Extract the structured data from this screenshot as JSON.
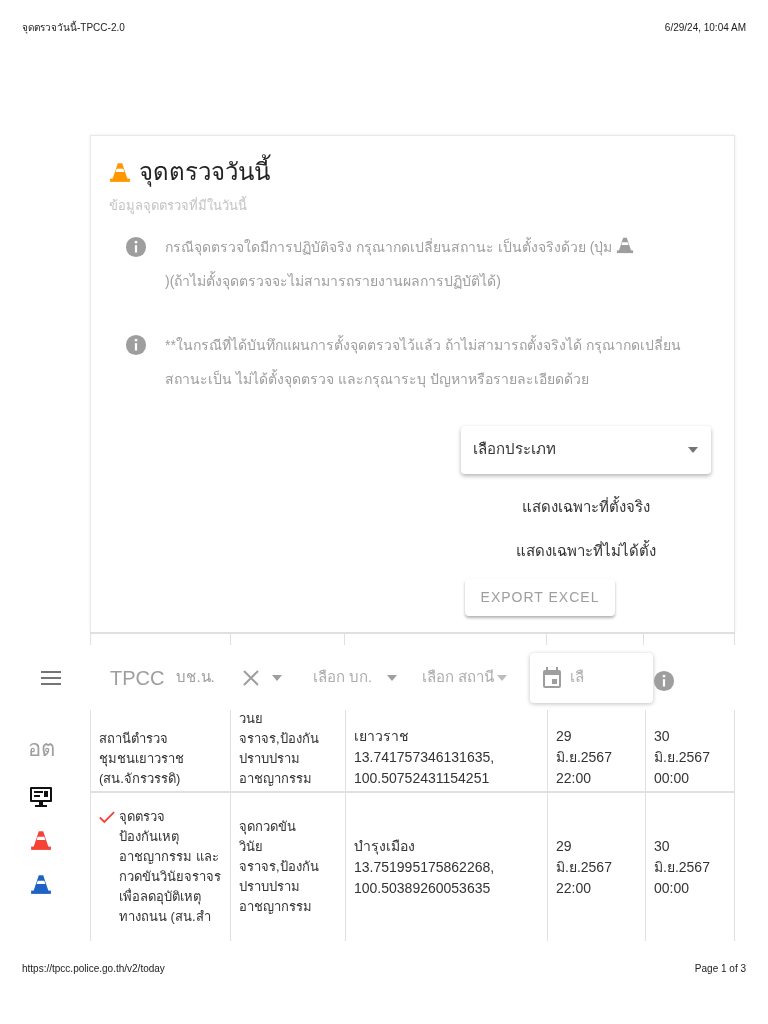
{
  "print_header": {
    "title": "จุดตรวจวันนี้-TPCC-2.0",
    "datetime": "6/29/24, 10:04 AM"
  },
  "card": {
    "title": "จุดตรวจวันนี้",
    "subtitle": "ข้อมูลจุดตรวจที่มีในวันนี้",
    "notes": [
      {
        "text_before": "กรณีจุดตรวจใดมีการปฏิบัติจริง กรุณากดเปลี่ยนสถานะ เป็นตั้งจริงด้วย (ปุ่ม",
        "has_cone": true,
        "text_after": ")(ถ้าไม่ตั้งจุดตรวจจะไม่สามารถรายงานผลการปฏิบัติได้)"
      },
      {
        "text_before": "**ในกรณีที่ได้บันทึกแผนการตั้งจุดตรวจไว้แล้ว ถ้าไม่สามารถตั้งจริงได้ กรุณากดเปลี่ยนสถานะเป็น ไม่ได้ตั้งจุดตรวจ และกรุณาระบุ ปัญหาหรือรายละเอียดด้วย",
        "has_cone": false
      }
    ],
    "type_select": {
      "placeholder": "เลือกประเภท"
    },
    "options": [
      "แสดงเฉพาะที่ตั้งจริง",
      "แสดงเฉพาะที่ไม่ได้ตั้ง"
    ],
    "export_button": "EXPORT EXCEL"
  },
  "app_bar": {
    "brand": "TPCC",
    "division": "บช.น.",
    "bk_placeholder": "เลือก บก.",
    "station_placeholder": "เลือก สถานี",
    "date_placeholder": "เลื"
  },
  "rail": [
    {
      "kind": "text",
      "label": "อต"
    },
    {
      "kind": "monitor"
    },
    {
      "kind": "cone",
      "color": "#f44336"
    },
    {
      "kind": "cone",
      "color": "#1e63c4"
    }
  ],
  "table": {
    "rows": [
      {
        "checked": false,
        "cells": [
          "สถานีตำรวจ\nชุมชนเยาวราช\n(สน.จักรวรรดิ)",
          "วนย\nจราจร,ป้องกัน\nปราบปราม\nอาชญากรรม",
          "เยาวราช\n13.741757346131635,\n100.50752431154251",
          "29\nมิ.ย.2567\n22:00",
          "30\nมิ.ย.2567\n00:00"
        ]
      },
      {
        "checked": true,
        "cells": [
          "จุดตรวจ\nป้องกันเหตุ\nอาชญากรรม และ\nกวดขันวินัยจราจร\nเพื่อลดอุบัติเหตุ\nทางถนน (สน.สำ",
          "จุดกวดขัน\nวินัย\nจราจร,ป้องกัน\nปราบปราม\nอาชญากรรม",
          "บำรุงเมือง\n13.751995175862268,\n100.50389260053635",
          "29\nมิ.ย.2567\n22:00",
          "30\nมิ.ย.2567\n00:00"
        ]
      }
    ]
  },
  "print_footer": {
    "url": "https://tpcc.police.go.th/v2/today",
    "page": "Page 1 of 3"
  }
}
